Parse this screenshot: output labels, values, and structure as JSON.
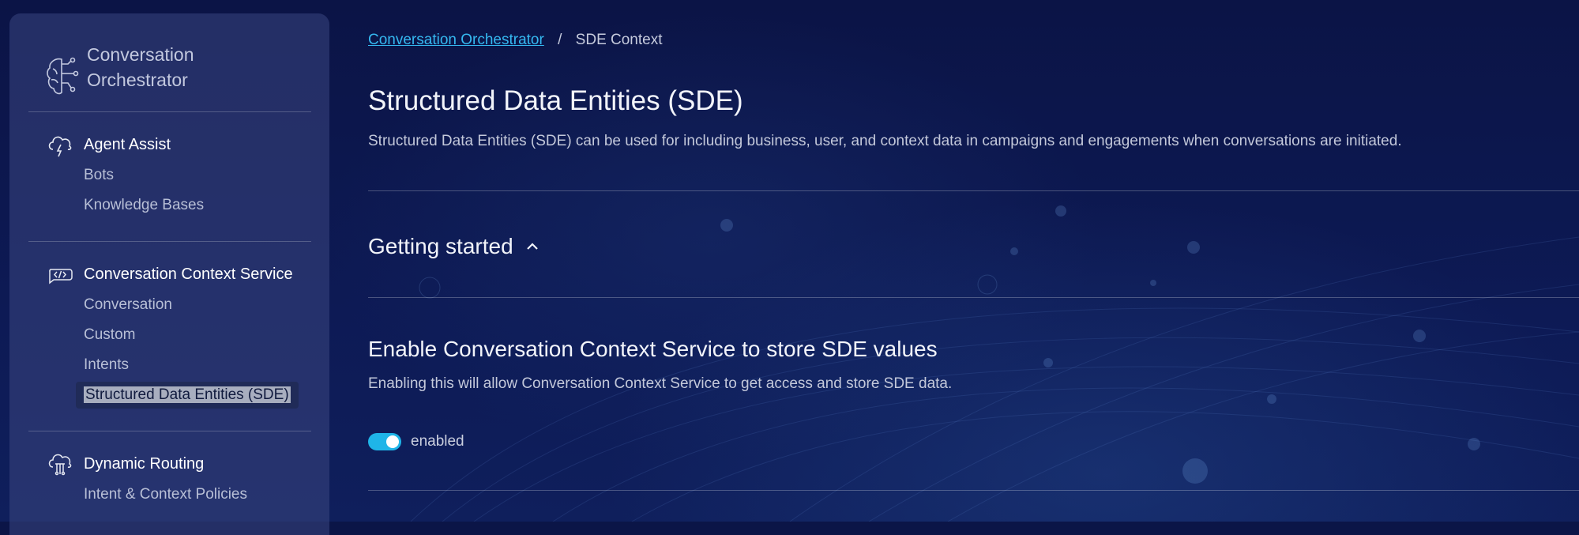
{
  "sidebar": {
    "brand": {
      "line1": "Conversation",
      "line2": "Orchestrator",
      "icon": "brain-circuit-icon"
    },
    "groups": [
      {
        "title": "Agent Assist",
        "icon": "cloud-lightning-icon",
        "items": [
          "Bots",
          "Knowledge Bases"
        ]
      },
      {
        "title": "Conversation Context Service",
        "icon": "code-bubble-icon",
        "items": [
          "Conversation",
          "Custom",
          "Intents",
          "Structured Data Entities (SDE)"
        ],
        "active_item": "Structured Data Entities (SDE)"
      },
      {
        "title": "Dynamic Routing",
        "icon": "cloud-routing-icon",
        "items": [
          "Intent & Context Policies"
        ]
      }
    ]
  },
  "breadcrumb": {
    "root": "Conversation Orchestrator",
    "separator": "/",
    "current": "SDE Context"
  },
  "page": {
    "title": "Structured Data Entities (SDE)",
    "description": "Structured Data Entities (SDE) can be used for including business, user, and context data in campaigns and engagements when conversations are initiated."
  },
  "getting_started": {
    "label": "Getting started",
    "icon": "chevron-up-icon"
  },
  "sde_section": {
    "title": "Enable Conversation Context Service to store SDE values",
    "description": "Enabling this will allow Conversation Context Service to get access and store SDE data.",
    "toggle": {
      "state": true,
      "label": "enabled"
    }
  },
  "colors": {
    "accent": "#1fb5e8",
    "link": "#35b8f0",
    "background": "#0b1547"
  }
}
